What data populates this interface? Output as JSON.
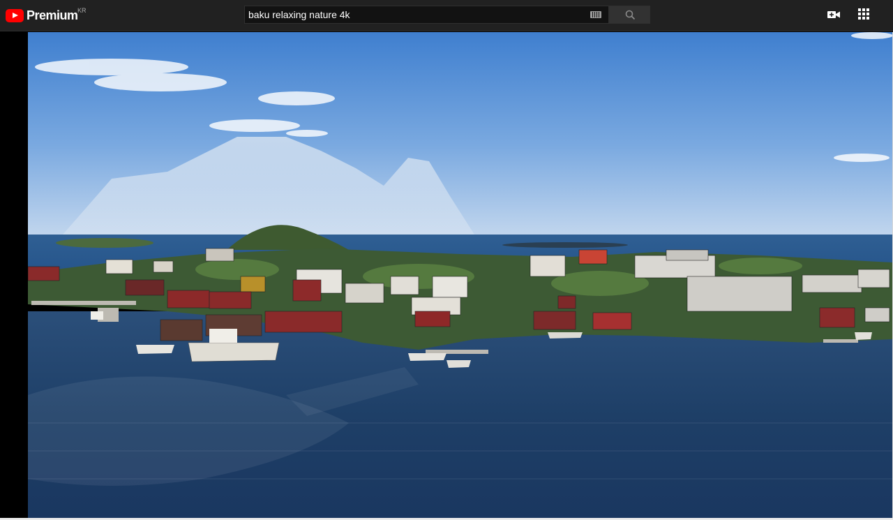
{
  "header": {
    "logo_text": "Premium",
    "country_code": "KR",
    "search_value": "baku relaxing nature 4k",
    "icons": [
      "keyboard-icon",
      "search-icon",
      "create-video-icon",
      "apps-grid-icon"
    ]
  },
  "colors": {
    "header_bg": "#212121",
    "search_bg": "#121212",
    "brand_red": "#ff0000",
    "sky": "#5b93d2",
    "water": "#1d3e64"
  },
  "video": {
    "scene": "aerial-harbor-village"
  }
}
